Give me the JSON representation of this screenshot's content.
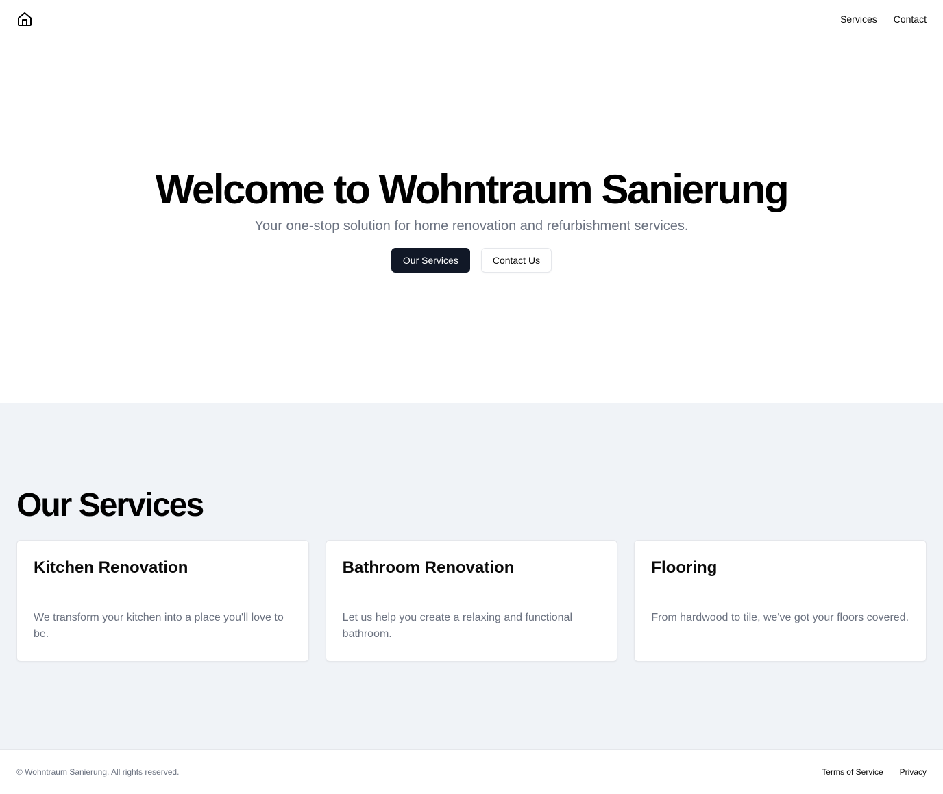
{
  "header": {
    "logo_icon": "home-icon",
    "nav": [
      {
        "label": "Services"
      },
      {
        "label": "Contact"
      }
    ]
  },
  "hero": {
    "title": "Welcome to Wohntraum Sanierung",
    "subtitle": "Your one-stop solution for home renovation and refurbishment services.",
    "primary_button": "Our Services",
    "secondary_button": "Contact Us"
  },
  "services": {
    "title": "Our Services",
    "cards": [
      {
        "title": "Kitchen Renovation",
        "description": "We transform your kitchen into a place you'll love to be."
      },
      {
        "title": "Bathroom Renovation",
        "description": "Let us help you create a relaxing and functional bathroom."
      },
      {
        "title": "Flooring",
        "description": "From hardwood to tile, we've got your floors covered."
      }
    ]
  },
  "footer": {
    "copyright": "© Wohntraum Sanierung. All rights reserved.",
    "links": [
      {
        "label": "Terms of Service"
      },
      {
        "label": "Privacy"
      }
    ]
  },
  "colors": {
    "primary_button_bg": "#111827",
    "services_bg": "#f0f3f7",
    "muted_text": "#6b7280",
    "border": "#e5e7eb"
  }
}
